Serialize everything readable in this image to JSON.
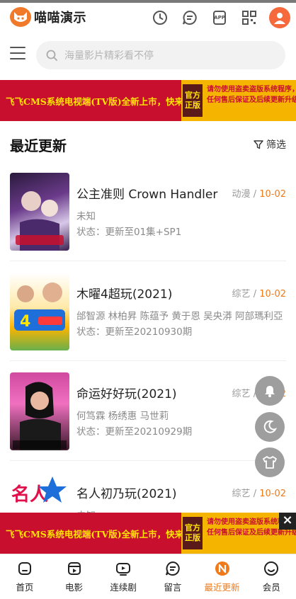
{
  "header": {
    "logo_text": "喵喵演示",
    "icons": [
      "history-icon",
      "message-icon",
      "app-icon",
      "qrcode-icon",
      "user-avatar-icon"
    ],
    "app_label": "APP"
  },
  "search": {
    "placeholder": "海量影片精彩看不停"
  },
  "banner": {
    "left_text": "飞飞CMS系统电视端(TV版)全新上市，快来抢购",
    "badge_line1": "官方",
    "badge_line2": "正版",
    "right_line1": "请勿使用盗卖盗版系统程序，没有",
    "right_line2": "任何售后保证及后续更新升级服务"
  },
  "section": {
    "title": "最近更新",
    "filter_label": "筛选"
  },
  "items": [
    {
      "title": "公主准则 Crown Handler",
      "category": "动漫",
      "sep": " / ",
      "date": "10-02",
      "actors": "未知",
      "status": "状态：更新至01集+SP1"
    },
    {
      "title": "木曜4超玩(2021)",
      "category": "综艺",
      "sep": " / ",
      "date": "10-02",
      "actors": "邰智源 林柏昇 陈蕴予 黄于恩 吴央漭 阿部瑪利亞",
      "status": "状态：更新至20210930期"
    },
    {
      "title": "命运好好玩(2021)",
      "category": "综艺",
      "sep": " / ",
      "date": "10-02",
      "actors": "何笃霖 杨绣惠 马世莉",
      "status": "状态：更新至20210929期"
    },
    {
      "title": "名人初乃玩(2021)",
      "category": "综艺",
      "sep": " / ",
      "date": "10-02",
      "actors": "未知",
      "status": ""
    }
  ],
  "tabbar": {
    "tabs": [
      {
        "label": "首页",
        "icon": "home-icon"
      },
      {
        "label": "电影",
        "icon": "film-icon"
      },
      {
        "label": "连续剧",
        "icon": "tv-play-icon"
      },
      {
        "label": "留言",
        "icon": "comment-icon"
      },
      {
        "label": "最近更新",
        "icon": "recent-update-icon",
        "active": true
      },
      {
        "label": "会员",
        "icon": "member-icon"
      }
    ]
  },
  "colors": {
    "accent": "#f07a1a",
    "banner_red": "#c8102e",
    "banner_yellow": "#f5b400"
  }
}
